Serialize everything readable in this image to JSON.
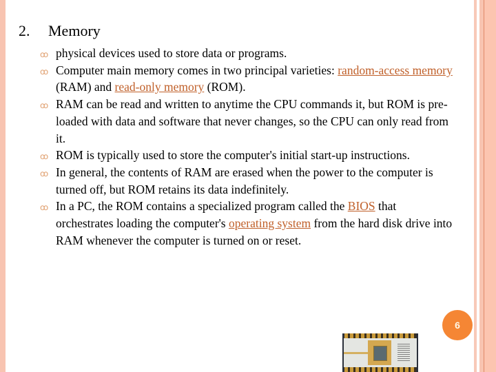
{
  "slide": {
    "heading": {
      "number": "2.",
      "title": "Memory"
    },
    "bullet_icon": "curl-bullet-icon",
    "bullets": [
      {
        "segments": [
          {
            "text": "physical devices used to store data or programs."
          }
        ]
      },
      {
        "segments": [
          {
            "text": "Computer main memory comes in two principal varieties: "
          },
          {
            "text": "random-access memory",
            "link": true
          },
          {
            "text": " (RAM) and "
          },
          {
            "text": "read-only memory",
            "link": true
          },
          {
            "text": " (ROM)."
          }
        ]
      },
      {
        "segments": [
          {
            "text": "RAM can be read and written to anytime the CPU commands it, but ROM is pre-loaded with data and software that never changes, so the CPU can only read from it."
          }
        ]
      },
      {
        "segments": [
          {
            "text": "ROM is typically used to store the computer's initial start-up instructions."
          }
        ]
      },
      {
        "segments": [
          {
            "text": "In general, the contents of RAM are erased when the power to the computer is turned off, but ROM retains its data indefinitely."
          }
        ]
      },
      {
        "segments": [
          {
            "text": "In a PC, the ROM contains a specialized program called the "
          },
          {
            "text": "BIOS",
            "link": true
          },
          {
            "text": " that orchestrates loading the computer's "
          },
          {
            "text": "operating system",
            "link": true
          },
          {
            "text": " from the hard disk drive into RAM whenever the computer is turned on or reset."
          }
        ]
      }
    ],
    "page_number": "6",
    "image": "eprom-chip-image",
    "colors": {
      "link": "#c0602a",
      "accent": "#f58634",
      "frame": "#f8c4b1"
    }
  }
}
